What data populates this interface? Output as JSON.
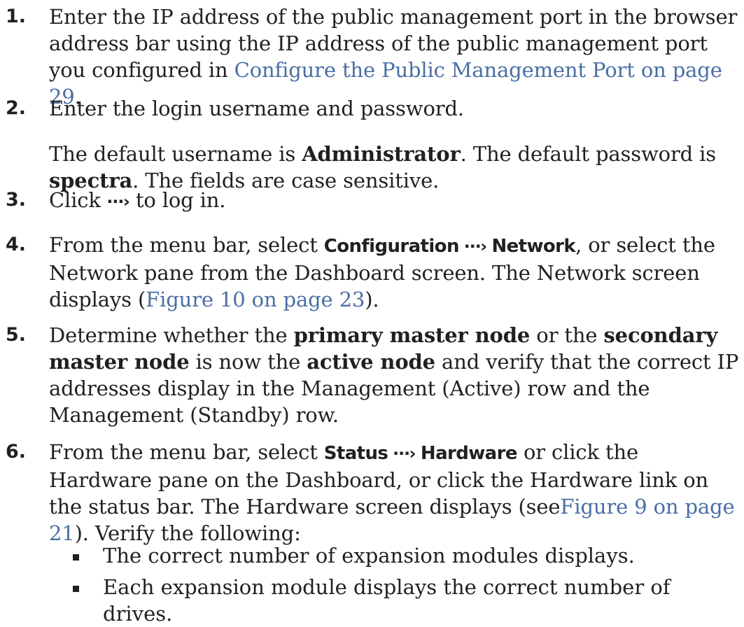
{
  "steps": [
    {
      "num": "1.",
      "parts": [
        "Enter the IP address of the public management port in the browser address bar using the IP address of the public management port you configured in ",
        "Configure the Public Management Port on page 29",
        "."
      ]
    },
    {
      "num": "2.",
      "text": "Enter the login username and password.",
      "sub": [
        "The default username is ",
        "Administrator",
        ". The default password is ",
        "spectra",
        ". The fields are case sensitive."
      ]
    },
    {
      "num": "3.",
      "parts": [
        "Click ",
        "⋯›",
        " to log in."
      ]
    },
    {
      "num": "4.",
      "parts": [
        "From the menu bar, select ",
        "Configuration",
        " ⋯› ",
        "Network",
        ", or select the Network pane from the Dashboard screen. The Network screen displays (",
        "Figure 10 on page 23",
        ")."
      ]
    },
    {
      "num": "5.",
      "parts": [
        "Determine whether the ",
        "primary master node",
        " or the ",
        "secondary master node",
        " is now the ",
        "active node",
        " and verify that the correct IP addresses display in the Management (Active) row and the Management (Standby) row."
      ]
    },
    {
      "num": "6.",
      "parts": [
        "From the menu bar, select ",
        "Status",
        " ⋯› ",
        "Hardware",
        " or click the Hardware pane on the Dashboard, or click the Hardware link on the status bar. The Hardware screen displays (see",
        "Figure 9 on page 21",
        "). Verify the following:"
      ]
    }
  ],
  "bullets": [
    "The correct number of expansion modules displays.",
    "Each expansion module displays the correct number of drives."
  ]
}
